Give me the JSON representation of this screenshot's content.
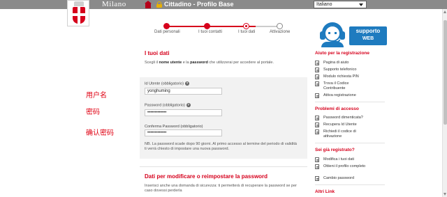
{
  "header": {
    "brand": "Milano",
    "app_title": "Cittadino - Profilo Base",
    "language": "Italiano"
  },
  "steps": [
    {
      "label": "Dati personali",
      "state": "done"
    },
    {
      "label": "I tuoi contatti",
      "state": "done"
    },
    {
      "label": "I tuoi dati",
      "state": "current"
    },
    {
      "label": "Attivazione",
      "state": "todo"
    }
  ],
  "support": {
    "line1": "supporto",
    "line2": "WEB"
  },
  "main": {
    "title": "I tuoi dati",
    "intro_prefix": "Scegli il ",
    "intro_bold1": "nome utente",
    "intro_mid": " e la ",
    "intro_bold2": "password",
    "intro_suffix": " che utilizzerai per accedere al portale.",
    "fields": {
      "username_label": "Id Utente (obbligatorio)",
      "username_value": "yonghuming",
      "password_label": "Password (obbligatorio)",
      "password_value": "•••••••••••••",
      "confirm_label": "Conferma Password (obbligatorio)",
      "confirm_value": "•••••••••••••"
    },
    "note_line1": "NB. La password scade dopo 90 giorni. Al primo accesso al termine del periodo di validità",
    "note_line2": "ti verrà chiesto di impostare una nuova password.",
    "recovery_title": "Dati per modificare o reimpostare la password",
    "recovery_line1": "Inserisci anche una domanda di sicurezza: ti permetterà di recuperare la password se per",
    "recovery_line2": "caso dovessi perderla"
  },
  "annotations": {
    "username": "用户名",
    "password": "密码",
    "confirm": "确认密码"
  },
  "sidebar": {
    "sections": [
      {
        "title": "Aiuto per la registrazione",
        "items": [
          "Pagina di aiuto",
          "Supporto telefonico",
          "Modulo richiesta PIN",
          "Trova il Codice Contribuente",
          "Attiva registrazione"
        ]
      },
      {
        "title": "Problemi di accesso",
        "items": [
          "Password dimenticata?",
          "Recupera Id Utente",
          "Richiedi il codice di attivazione"
        ]
      },
      {
        "title": "Sei già registrato?",
        "items": [
          "Modifica i tuoi dati",
          "Ottieni il profilo completo",
          "Cambio password"
        ]
      },
      {
        "title": "Altri Link",
        "items": []
      }
    ]
  },
  "colors": {
    "accent": "#d6001c",
    "support_blue": "#1e7bbf",
    "topbar": "#8a8a8a"
  }
}
